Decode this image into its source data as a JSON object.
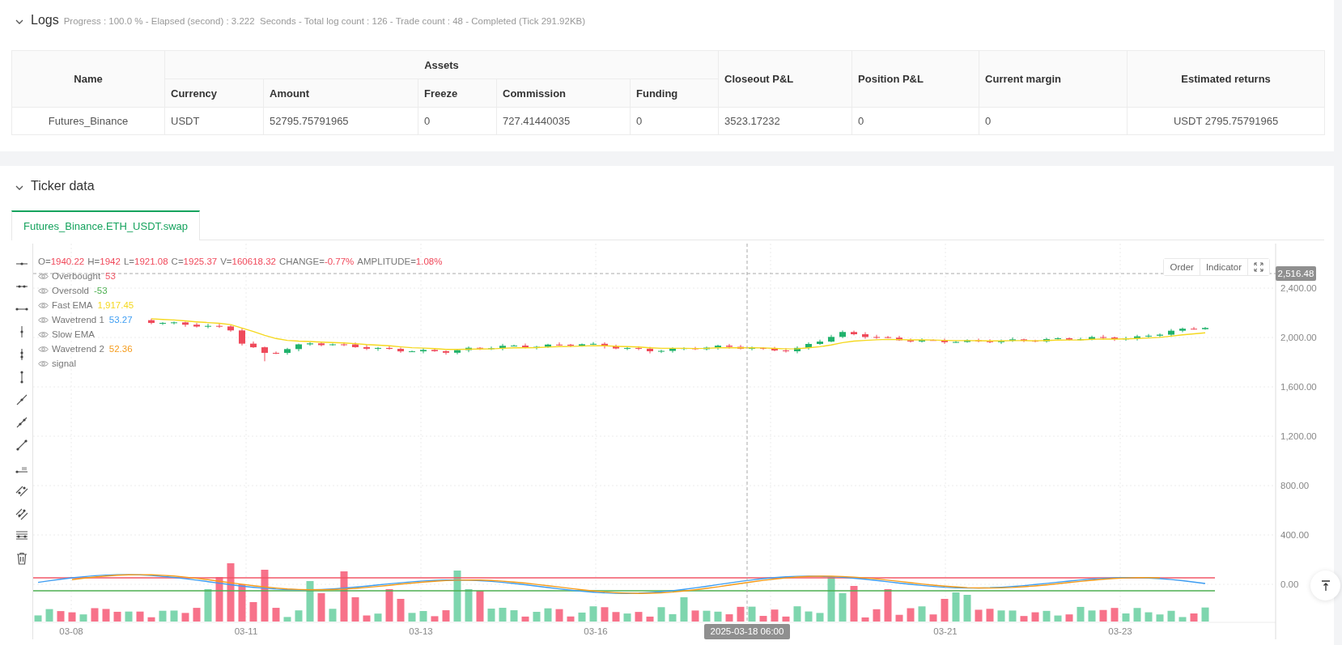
{
  "logs": {
    "title": "Logs",
    "expanded": true,
    "summary": "Progress : 100.0 % - Elapsed (second) : 3.222  Seconds - Total log count : 126 - Trade count : 48 - Completed (Tick 291.92KB)"
  },
  "table": {
    "columns": [
      {
        "label": "Name"
      },
      {
        "label": "Assets",
        "colspan": 5,
        "children": [
          {
            "label": "Currency"
          },
          {
            "label": "Amount"
          },
          {
            "label": "Freeze"
          },
          {
            "label": "Commission"
          },
          {
            "label": "Funding"
          }
        ]
      },
      {
        "label": "Closeout P&L"
      },
      {
        "label": "Position P&L"
      },
      {
        "label": "Current margin"
      },
      {
        "label": "Estimated returns"
      }
    ],
    "rows": [
      [
        "Futures_Binance",
        "USDT",
        "52795.75791965",
        "0",
        "727.41440035",
        "0",
        "3523.17232",
        "0",
        "0",
        "USDT 2795.75791965"
      ]
    ]
  },
  "ticker": {
    "title": "Ticker data",
    "expanded": true,
    "tabs": [
      {
        "label": "Futures_Binance.ETH_USDT.swap",
        "selected": true
      }
    ],
    "chart": {
      "ohlc": {
        "falling": true,
        "fields": [
          {
            "label": "O=",
            "value": "1940.22"
          },
          {
            "label": "H=",
            "value": "1942"
          },
          {
            "label": "L=",
            "value": "1921.08"
          },
          {
            "label": "C=",
            "value": "1925.37"
          },
          {
            "label": "V=",
            "value": "160618.32"
          },
          {
            "label": "CHANGE=",
            "value": "-0.77%"
          },
          {
            "label": "AMPLITUDE=",
            "value": "1.08%"
          }
        ]
      },
      "legend": [
        {
          "label": "Overbought",
          "value": "53",
          "color": "#f25767"
        },
        {
          "label": "Oversold",
          "value": "-53",
          "color": "#4caf50"
        },
        {
          "label": "Fast EMA",
          "value": "1,917.45",
          "color": "#f5d81f"
        },
        {
          "label": "Wavetrend 1",
          "value": "53.27",
          "color": "#3d9df2"
        },
        {
          "label": "Slow EMA"
        },
        {
          "label": "Wavetrend 2",
          "value": "52.36",
          "color": "#f59b1a"
        },
        {
          "label": "signal"
        }
      ],
      "buttons": [
        {
          "label": "Order"
        },
        {
          "label": "Indicator"
        }
      ],
      "price_axis": [
        "2,400.00",
        "2,000.00",
        "1,600.00",
        "1,200.00",
        "800.00",
        "400.00",
        "0.00"
      ],
      "time_axis": [
        "03-08",
        "03-11",
        "03-13",
        "03-16",
        "03-21",
        "03-23"
      ],
      "crosshair": {
        "price": "2,516.48",
        "time": "2025-03-18 06:00"
      }
    }
  }
}
